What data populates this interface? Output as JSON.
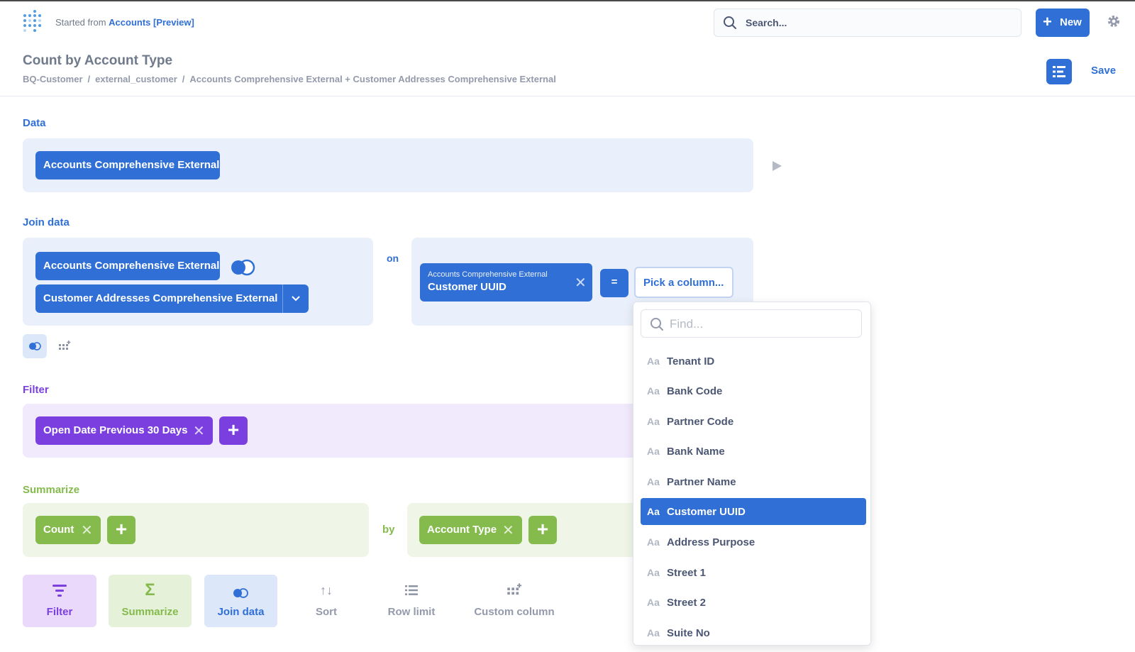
{
  "header": {
    "started_prefix": "Started from",
    "started_link": "Accounts [Preview]",
    "search_placeholder": "Search...",
    "new_label": "New",
    "title": "Count by Account Type",
    "breadcrumbs": [
      "BQ-Customer",
      "external_customer",
      "Accounts Comprehensive External + Customer Addresses Comprehensive External"
    ],
    "save_label": "Save"
  },
  "data_section": {
    "label": "Data",
    "table": "Accounts Comprehensive External"
  },
  "join_section": {
    "label": "Join data",
    "left_table": "Accounts Comprehensive External",
    "right_table": "Customer Addresses Comprehensive External",
    "on_label": "on",
    "left_column_table": "Accounts Comprehensive External",
    "left_column": "Customer UUID",
    "operator": "=",
    "pick_column": "Pick a column..."
  },
  "filter_section": {
    "label": "Filter",
    "filter": "Open Date Previous 30 Days"
  },
  "summarize_section": {
    "label": "Summarize",
    "metric": "Count",
    "by_label": "by",
    "group_by": "Account Type"
  },
  "actions": [
    {
      "label": "Filter",
      "icon": "filter-icon"
    },
    {
      "label": "Summarize",
      "icon": "sigma-icon"
    },
    {
      "label": "Join data",
      "icon": "join-icon"
    },
    {
      "label": "Sort",
      "icon": "sort-icon"
    },
    {
      "label": "Row limit",
      "icon": "list-icon"
    },
    {
      "label": "Custom column",
      "icon": "custom-column-icon"
    }
  ],
  "column_picker": {
    "find_placeholder": "Find...",
    "type_glyph": "Aa",
    "options": [
      "Tenant ID",
      "Bank Code",
      "Partner Code",
      "Bank Name",
      "Partner Name",
      "Customer UUID",
      "Address Purpose",
      "Street 1",
      "Street 2",
      "Suite No"
    ],
    "selected": "Customer UUID"
  },
  "colors": {
    "brand": "#2f6fd6",
    "filter": "#7b3fe0",
    "summarize": "#84bb4c"
  }
}
